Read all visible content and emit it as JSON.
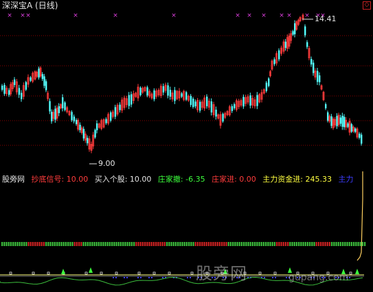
{
  "header": {
    "title": "深深宝A (日线)",
    "close_glyph": "◇"
  },
  "main_chart": {
    "high_label": "14.41",
    "low_label": "9.00",
    "marker_glyph": "×",
    "marker_color": "#e040e0",
    "up_color": "#ff3c3c",
    "down_color": "#54ffff",
    "grid_color": "#8b0000"
  },
  "indicator": {
    "source": "股旁网",
    "items": [
      {
        "label": "抄底信号: 10.00",
        "color": "#ff3c3c"
      },
      {
        "label": "买入个股: 10.00",
        "color": "#e6e6e6"
      },
      {
        "label": "庄家撤: -6.35",
        "color": "#3cff3c"
      },
      {
        "label": "庄家进: 0.00",
        "color": "#ff3c3c"
      },
      {
        "label": "主力资金进: 245.33",
        "color": "#ffff40"
      },
      {
        "label": "主力",
        "color": "#3c3cff"
      }
    ]
  },
  "watermark": {
    "text": "股旁网",
    "url": "gupang.com"
  },
  "chart_data": {
    "type": "candlestick",
    "title": "深深宝A (日线)",
    "annotations": [
      {
        "text": "14.41",
        "kind": "high"
      },
      {
        "text": "9.00",
        "kind": "low"
      }
    ]
  }
}
